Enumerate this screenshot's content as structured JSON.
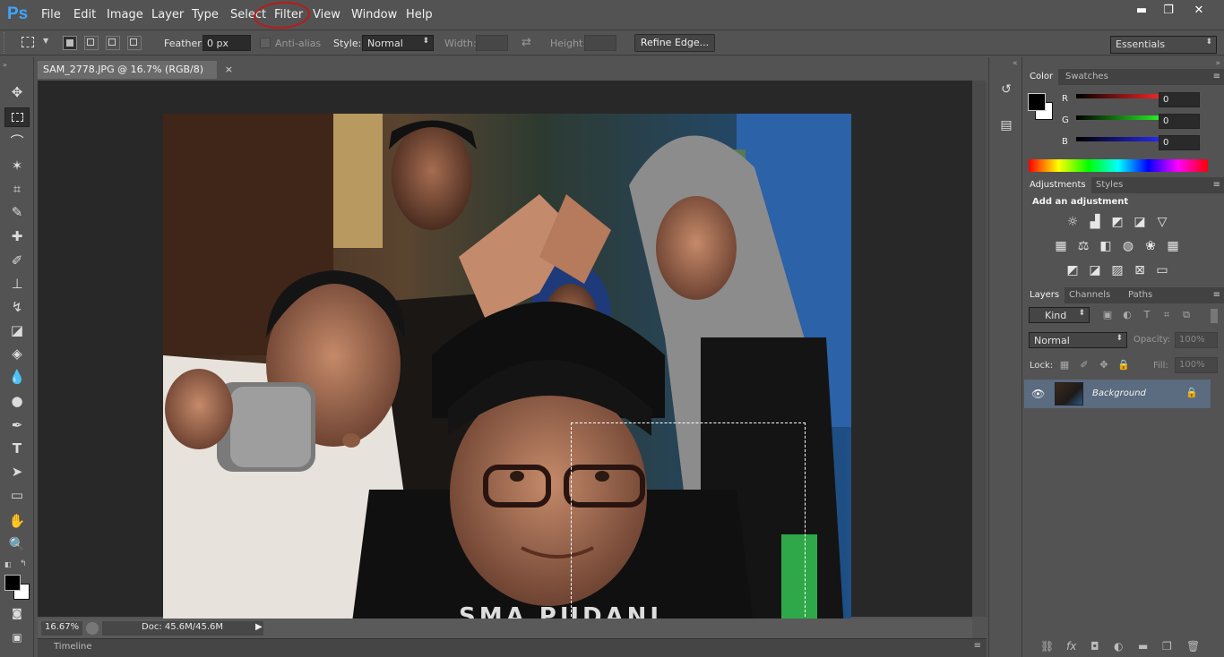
{
  "app": {
    "logo": "Ps"
  },
  "menu": [
    "File",
    "Edit",
    "Image",
    "Layer",
    "Type",
    "Select",
    "Filter",
    "View",
    "Window",
    "Help"
  ],
  "window_controls": {
    "minimize": "▬",
    "restore": "❐",
    "close": "✕"
  },
  "options": {
    "feather_label": "Feather:",
    "feather_value": "0 px",
    "antialias_label": "Anti-alias",
    "style_label": "Style:",
    "style_value": "Normal",
    "width_label": "Width:",
    "height_label": "Height:",
    "refine_edge": "Refine Edge...",
    "workspace": "Essentials"
  },
  "document": {
    "tab_title": "SAM_2778.JPG @ 16.7% (RGB/8)",
    "zoom": "16.67%",
    "doc_size": "Doc: 45.6M/45.6M",
    "timeline_label": "Timeline"
  },
  "color_panel": {
    "tabs": [
      "Color",
      "Swatches"
    ],
    "channels": [
      {
        "label": "R",
        "value": "0",
        "color": "#ff2a2a"
      },
      {
        "label": "G",
        "value": "0",
        "color": "#2aff2a"
      },
      {
        "label": "B",
        "value": "0",
        "color": "#2a2aff"
      }
    ]
  },
  "adjustments_panel": {
    "tabs": [
      "Adjustments",
      "Styles"
    ],
    "heading": "Add an adjustment"
  },
  "layers_panel": {
    "tabs": [
      "Layers",
      "Channels",
      "Paths"
    ],
    "filter_kind": "Kind",
    "blend_mode": "Normal",
    "opacity_label": "Opacity:",
    "opacity_value": "100%",
    "lock_label": "Lock:",
    "fill_label": "Fill:",
    "fill_value": "100%",
    "layers": [
      {
        "name": "Background"
      }
    ]
  },
  "colors": {
    "accent": "#3fa5ff",
    "annotation": "#c01818",
    "selected_layer": "#5b6b80"
  }
}
